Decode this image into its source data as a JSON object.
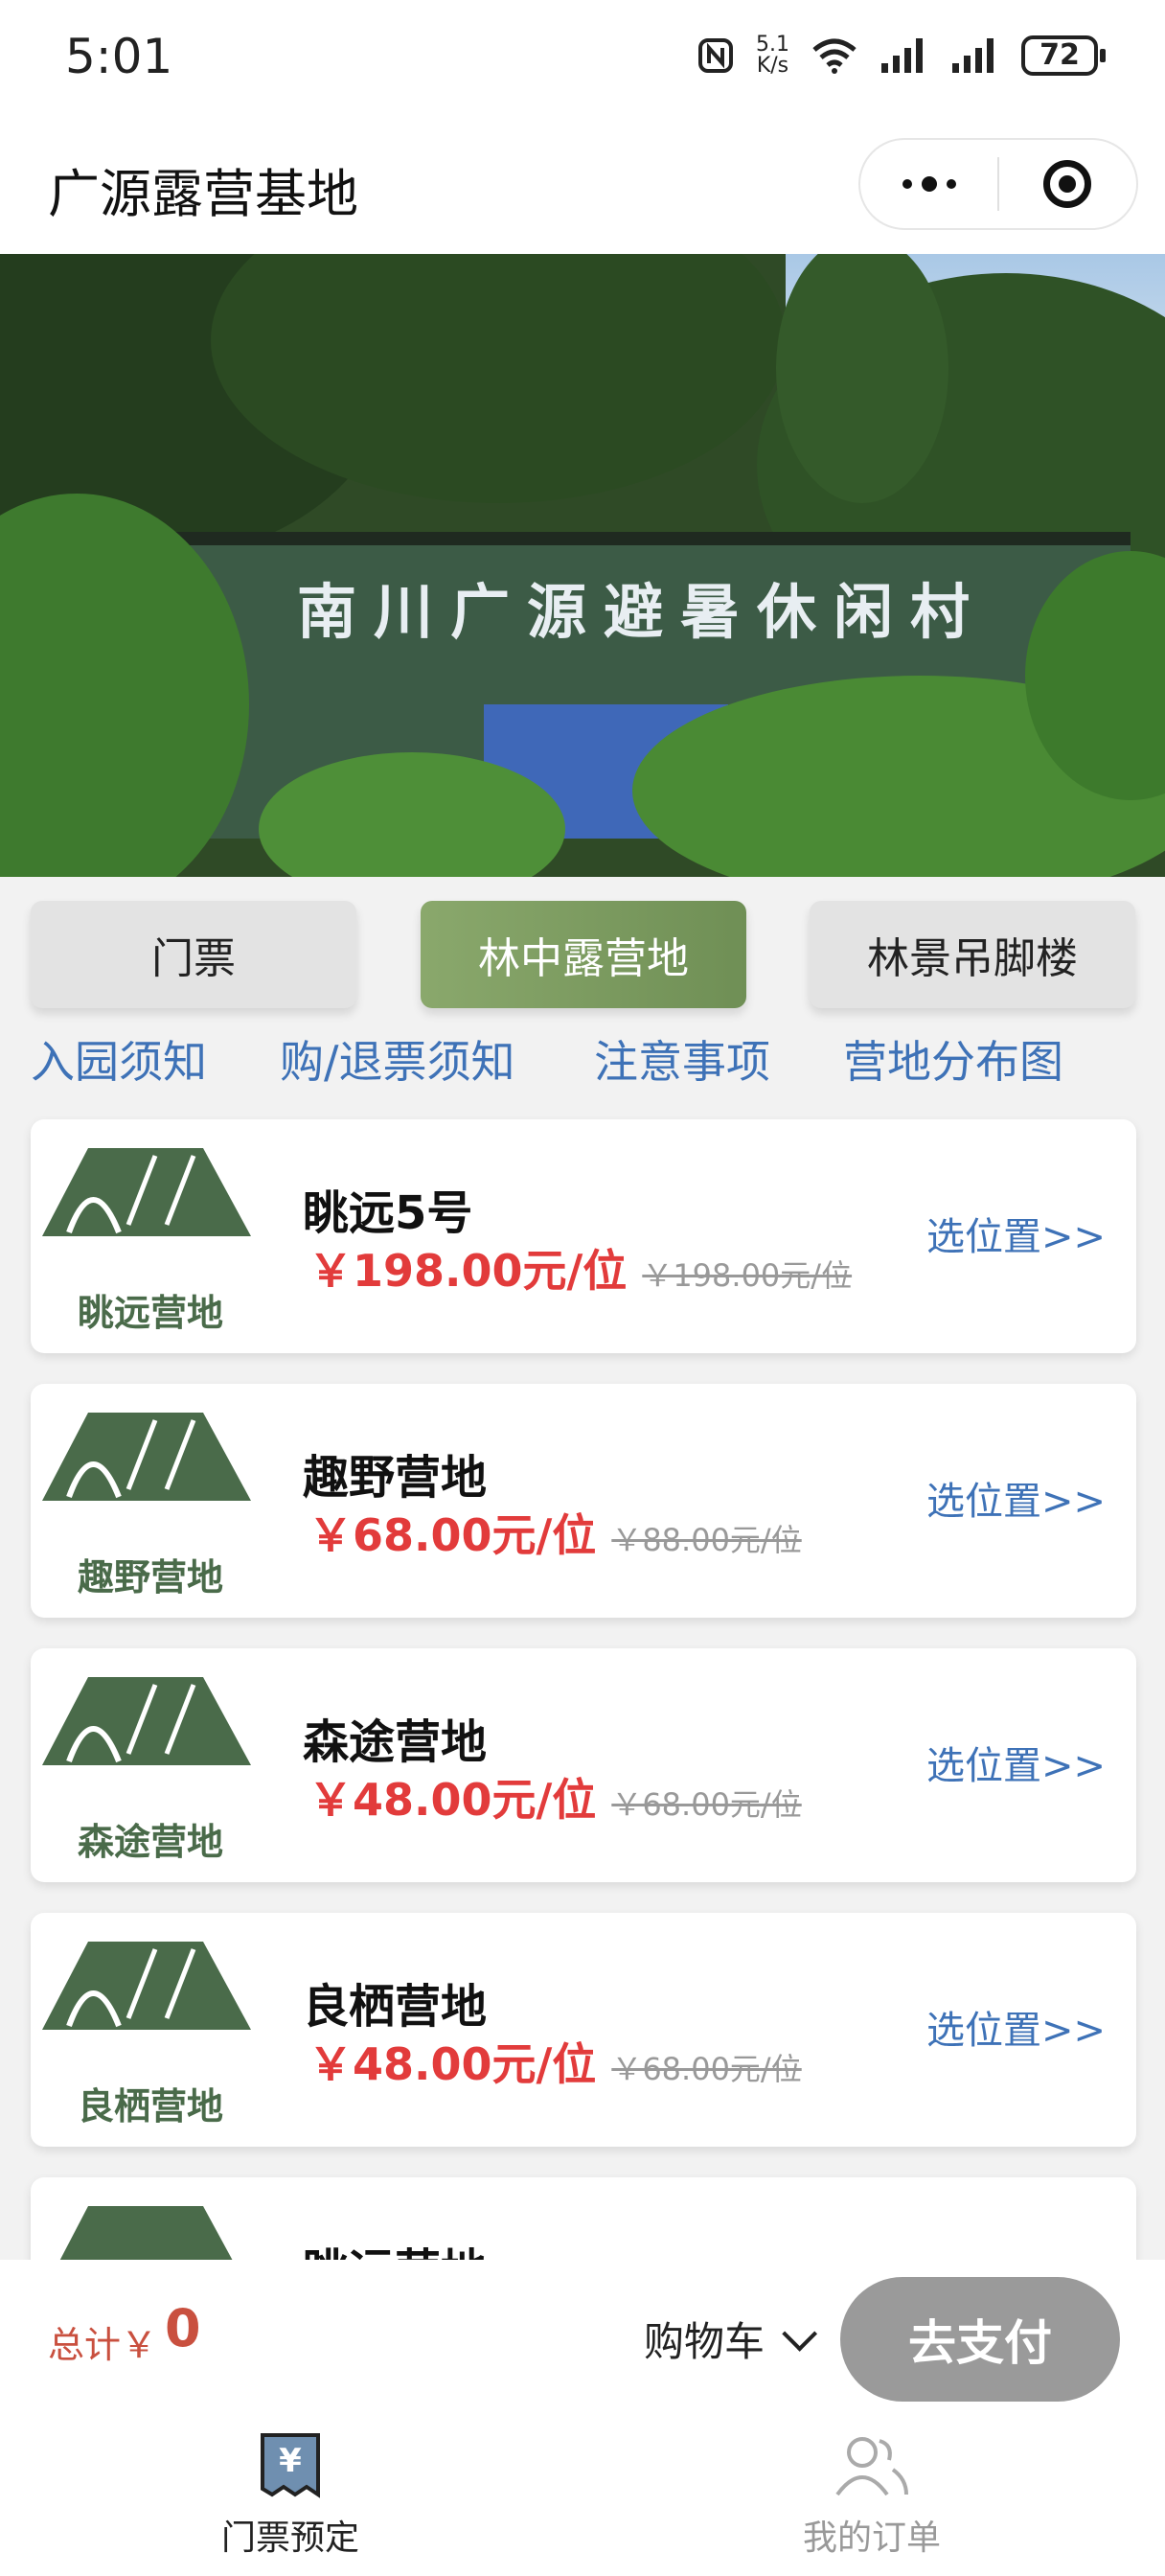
{
  "status_bar": {
    "time": "5:01",
    "speed": "5.1\nK/s",
    "battery": "72"
  },
  "nav": {
    "title": "广源露营基地"
  },
  "banner": {
    "sign_text": "南川广源避暑休闲村"
  },
  "category_tabs": [
    {
      "label": "门票",
      "active": false
    },
    {
      "label": "林中露营地",
      "active": true
    },
    {
      "label": "林景吊脚楼",
      "active": false
    }
  ],
  "info_links": [
    "入园须知",
    "购/退票须知",
    "注意事项",
    "营地分布图"
  ],
  "camps": [
    {
      "logo_text": "眺远营地",
      "name": "眺远5号",
      "price": "￥198.00元/位",
      "original_price": "￥198.00元/位",
      "action": "选位置>>"
    },
    {
      "logo_text": "趣野营地",
      "name": "趣野营地",
      "price": "￥68.00元/位",
      "original_price": "￥88.00元/位",
      "action": "选位置>>"
    },
    {
      "logo_text": "森途营地",
      "name": "森途营地",
      "price": "￥48.00元/位",
      "original_price": "￥68.00元/位",
      "action": "选位置>>"
    },
    {
      "logo_text": "良栖营地",
      "name": "良栖营地",
      "price": "￥48.00元/位",
      "original_price": "￥68.00元/位",
      "action": "选位置>>"
    },
    {
      "logo_text": "",
      "name": "眺远营地",
      "price": "",
      "original_price": "",
      "action": ""
    }
  ],
  "cart": {
    "total_label": "总计￥",
    "total_value": "0",
    "cart_label": "购物车",
    "pay_button": "去支付"
  },
  "tabbar": [
    {
      "label": "门票预定",
      "icon": "ticket-icon",
      "active": true
    },
    {
      "label": "我的订单",
      "icon": "users-icon",
      "active": false
    }
  ],
  "colors": {
    "accent_green": "#7a9a5e",
    "price_red": "#e23b3b",
    "link_blue": "#3e72b7",
    "tent_green": "#4a6b4a"
  }
}
